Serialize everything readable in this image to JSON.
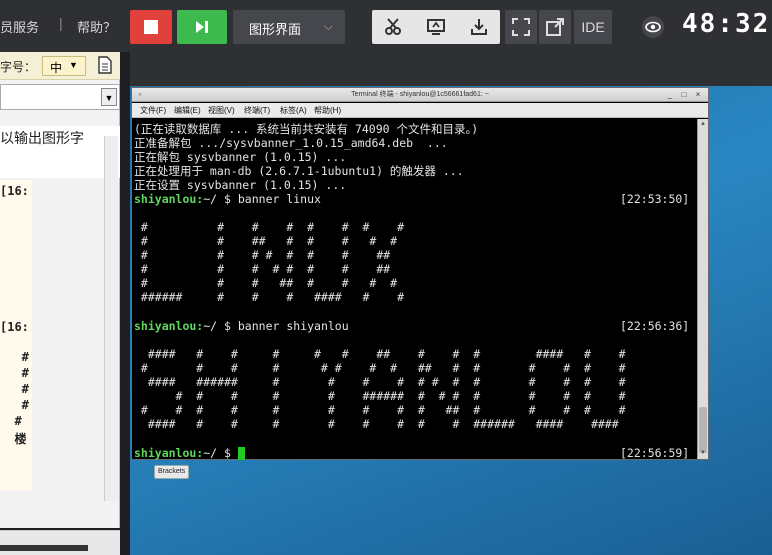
{
  "header": {
    "member_link": "员服务",
    "separator": "|",
    "help_link": "帮助？",
    "mode_label": "图形界面",
    "ide_label": "IDE",
    "timer": "48:32"
  },
  "left_panel": {
    "size_label": "字号：",
    "size_value": "中",
    "doc_text": "以输出图形字",
    "term_lines": [
      "[16:",
      "[16:",
      "   #",
      "   #",
      "   #",
      "   #",
      "  #",
      "  楼",
      "   "
    ],
    "term_line_tops": [
      0,
      0,
      0,
      0,
      0,
      0,
      0,
      0,
      0
    ]
  },
  "terminal": {
    "window_title": "Terminal 终端 - shiyanlou@1c56661fad61: ~",
    "menu": [
      "文件(F)",
      "编辑(E)",
      "视图(V)",
      "终端(T)",
      "标签(A)",
      "帮助(H)"
    ],
    "lines": [
      "(正在读取数据库 ... 系统当前共安装有 74090 个文件和目录。)",
      "正准备解包 .../sysvbanner_1.0.15_amd64.deb  ...",
      "正在解包 sysvbanner (1.0.15) ...",
      "正在处理用于 man-db (2.6.7.1-1ubuntu1) 的触发器 ...",
      "正在设置 sysvbanner (1.0.15) ..."
    ],
    "prompt_user": "shiyanlou:",
    "prompt_path": "~/ $ ",
    "cmd1": "banner linux",
    "time1": "[22:53:50]",
    "banner_linux": [
      "",
      " #          #    #    #  #    #  #    #",
      " #          #    ##   #  #    #   #  #",
      " #          #    # #  #  #    #    ##",
      " #          #    #  # #  #    #    ##",
      " #          #    #   ##  #    #   #  #",
      " ######     #    #    #   ####   #    #",
      ""
    ],
    "cmd2": "banner shiyanlou",
    "time2": "[22:56:36]",
    "banner_shiyanlou": [
      "",
      "  ####   #    #     #     #   #    ##    #    #  #        ####   #    #",
      " #       #    #     #      # #    #  #   ##   #  #       #    #  #    #",
      "  ####   ######     #       #    #    #  # #  #  #       #    #  #    #",
      "      #  #    #     #       #    ######  #  # #  #       #    #  #    #",
      " #    #  #    #     #       #    #    #  #   ##  #       #    #  #    #",
      "  ####   #    #     #       #    #    #  #    #  ######   ####    ####"
    ],
    "time3": "[22:56:59]"
  },
  "tooltip": "Brackets"
}
